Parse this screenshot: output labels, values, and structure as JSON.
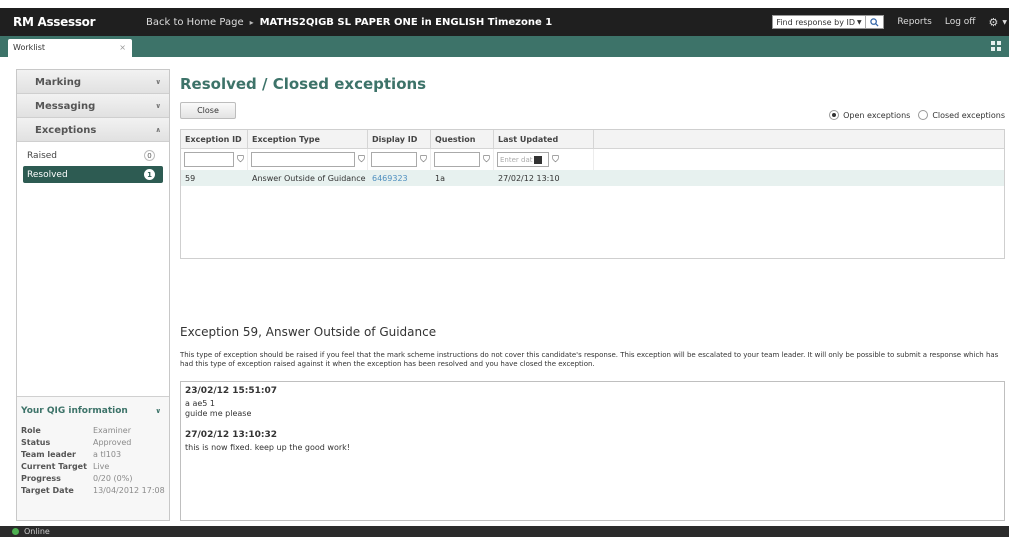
{
  "header": {
    "brand": "RM Assessor",
    "back_link": "Back to Home Page",
    "separator": "▸",
    "title": "MATHS2QIGB SL PAPER ONE in ENGLISH Timezone 1",
    "find_placeholder": "Find response by ID",
    "reports": "Reports",
    "logoff": "Log off"
  },
  "tabs": {
    "worklist": "Worklist"
  },
  "sidebar": {
    "sections": {
      "marking": "Marking",
      "messaging": "Messaging",
      "exceptions": "Exceptions"
    },
    "items": [
      {
        "label": "Raised",
        "count": "0"
      },
      {
        "label": "Resolved",
        "count": "1"
      }
    ],
    "qig": {
      "heading": "Your QIG information",
      "rows": [
        {
          "k": "Role",
          "v": "Examiner"
        },
        {
          "k": "Status",
          "v": "Approved"
        },
        {
          "k": "Team leader",
          "v": "a tl103"
        },
        {
          "k": "Current Target",
          "v": "Live"
        },
        {
          "k": "Progress",
          "v": "0/20 (0%)"
        },
        {
          "k": "Target Date",
          "v": "13/04/2012 17:08"
        }
      ]
    }
  },
  "main": {
    "title": "Resolved / Closed exceptions",
    "close_button": "Close",
    "radio_open": "Open exceptions",
    "radio_closed": "Closed exceptions",
    "columns": [
      "Exception ID",
      "Exception Type",
      "Display ID",
      "Question",
      "Last Updated"
    ],
    "date_placeholder": "Enter dat",
    "row": {
      "id": "59",
      "type": "Answer Outside of Guidance",
      "display_id": "6469323",
      "question": "1a",
      "updated": "27/02/12 13:10"
    },
    "exception_title": "Exception 59,  Answer Outside of Guidance",
    "exception_desc": "This type of exception should be raised if you feel that the mark scheme instructions do not cover this candidate's response. This exception will be escalated to your team leader. It will only be possible to submit a response which has had this type of exception raised against it when the exception has been resolved and you have closed the exception.",
    "notes": [
      {
        "time": "23/02/12 15:51:07",
        "line1": "a ae5 1",
        "line2": "guide me please"
      },
      {
        "time": "27/02/12 13:10:32",
        "line1": "this is now fixed. keep up the good work!",
        "line2": ""
      }
    ]
  },
  "status": {
    "label": "Online",
    "color": "#4caf50"
  }
}
